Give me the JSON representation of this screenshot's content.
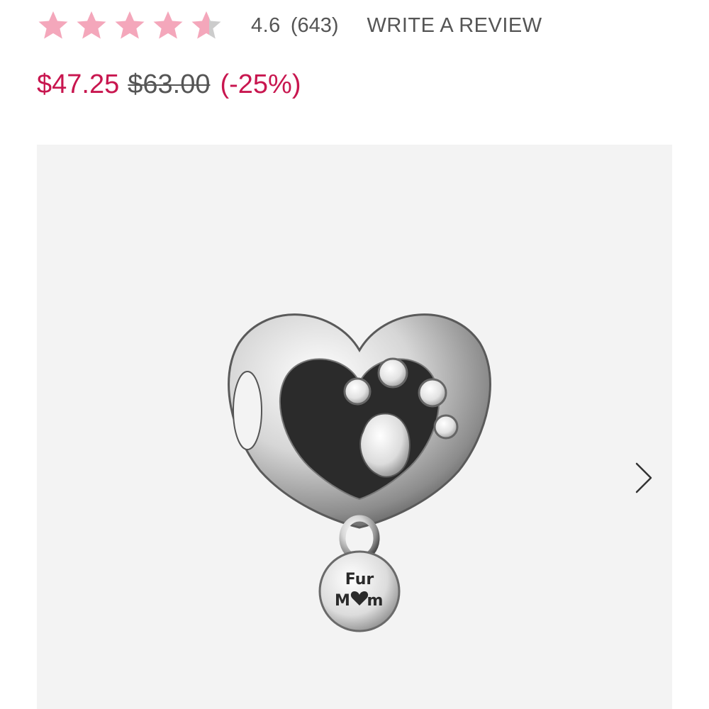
{
  "rating": {
    "value": "4.6",
    "count": "(643)",
    "stars_filled": 4.6,
    "star_color": "#f4a7bb",
    "star_empty_color": "#cccccc",
    "write_review_label": "WRITE A REVIEW"
  },
  "price": {
    "sale": "$47.25",
    "original": "$63.00",
    "discount": "(-25%)",
    "accent_color": "#c8164f"
  },
  "gallery": {
    "background": "#f3f3f3",
    "engraving_line1": "Fur",
    "engraving_line2_a": "M",
    "engraving_line2_b": "m",
    "next_icon": "chevron-right-icon"
  }
}
